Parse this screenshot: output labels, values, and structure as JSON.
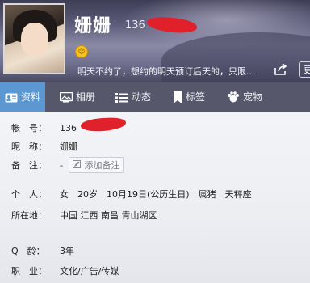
{
  "header": {
    "nickname": "姗姗",
    "qq_prefix": "136",
    "signature": "明天不约了，想约的明天预订后天的，只限...",
    "more_button": "更"
  },
  "tabs": [
    {
      "label": "资料",
      "icon": "profile-card-icon",
      "active": true
    },
    {
      "label": "相册",
      "icon": "photo-album-icon",
      "active": false
    },
    {
      "label": "动态",
      "icon": "feed-list-icon",
      "active": false
    },
    {
      "label": "标签",
      "icon": "bookmark-tag-icon",
      "active": false
    },
    {
      "label": "宠物",
      "icon": "pet-paw-icon",
      "active": false
    }
  ],
  "profile": {
    "account_label": "帐　号：",
    "account_value": "136",
    "nick_label": "昵　称：",
    "nick_value": "姗姗",
    "remark_label": "备　注：",
    "remark_value": "-",
    "add_remark": "添加备注",
    "personal_label": "个　人：",
    "personal_value": "女　20岁　10月19日(公历生日)　属猪　天秤座",
    "location_label": "所在地：",
    "location_value": "中国 江西 南昌 青山湖区",
    "qage_label": "Q　龄：",
    "qage_value": "3年",
    "job_label": "职　业：",
    "job_value": "文化/广告/传媒"
  },
  "colors": {
    "tab_active": "#5b97d1",
    "tab_bar": "#4a4a5f",
    "redaction": "#e0202a"
  }
}
